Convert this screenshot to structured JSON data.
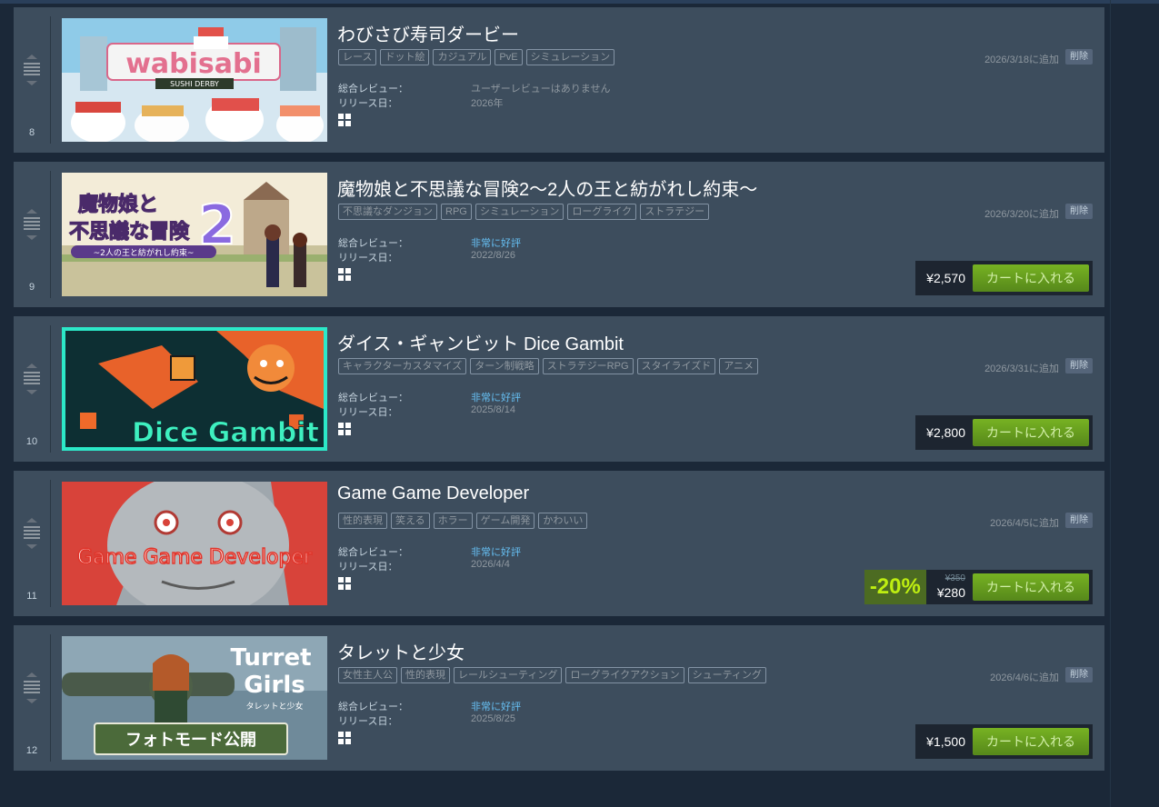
{
  "labels": {
    "review": "総合レビュー：",
    "release": "リリース日：",
    "remove": "削除",
    "cart": "カートに入れる"
  },
  "items": [
    {
      "rank": "8",
      "title": "わびさび寿司ダービー",
      "tags": [
        "レース",
        "ドット絵",
        "カジュアル",
        "PvE",
        "シミュレーション"
      ],
      "added": "2026/3/18に追加",
      "review": "ユーザーレビューはありません",
      "release": "2026年",
      "platform": "windows-icon",
      "capsule_text": "wabisabi",
      "capsule_sub": "SUSHI DERBY"
    },
    {
      "rank": "9",
      "title": "魔物娘と不思議な冒険2～2人の王と紡がれし約束～",
      "tags": [
        "不思議なダンジョン",
        "RPG",
        "シミュレーション",
        "ローグライク",
        "ストラテジー"
      ],
      "added": "2026/3/20に追加",
      "review": "非常に好評",
      "release": "2022/8/26",
      "platform": "windows-icon",
      "price": "¥2,570",
      "capsule_text": "魔物娘と 不思議な冒険",
      "capsule_num": "2",
      "capsule_sub": "~2人の王と紡がれし約束~"
    },
    {
      "rank": "10",
      "title": "ダイス・ギャンビット Dice Gambit",
      "tags": [
        "キャラクターカスタマイズ",
        "ターン制戦略",
        "ストラテジーRPG",
        "スタイライズド",
        "アニメ"
      ],
      "added": "2026/3/31に追加",
      "review": "非常に好評",
      "release": "2025/8/14",
      "platform": "windows-icon",
      "price": "¥2,800",
      "capsule_text": "Dice Gambit"
    },
    {
      "rank": "11",
      "title": "Game Game Developer",
      "tags": [
        "性的表現",
        "笑える",
        "ホラー",
        "ゲーム開発",
        "かわいい"
      ],
      "added": "2026/4/5に追加",
      "review": "非常に好評",
      "release": "2026/4/4",
      "platform": "windows-icon",
      "discount": "-20%",
      "original_price": "¥350",
      "price": "¥280",
      "capsule_text": "Game Game Developer"
    },
    {
      "rank": "12",
      "title": "タレットと少女",
      "tags": [
        "女性主人公",
        "性的表現",
        "レールシューティング",
        "ローグライクアクション",
        "シューティング"
      ],
      "added": "2026/4/6に追加",
      "review": "非常に好評",
      "release": "2025/8/25",
      "platform": "windows-icon",
      "price": "¥1,500",
      "capsule_text": "Turret Girls",
      "capsule_sub": "タレットと少女",
      "capsule_banner": "フォトモード公開"
    }
  ],
  "colors": {
    "background": "#1b2838",
    "row": "#3d4d5d",
    "positive_review": "#66c0f4",
    "cart_button": "#75b022",
    "discount": "#beee11"
  }
}
